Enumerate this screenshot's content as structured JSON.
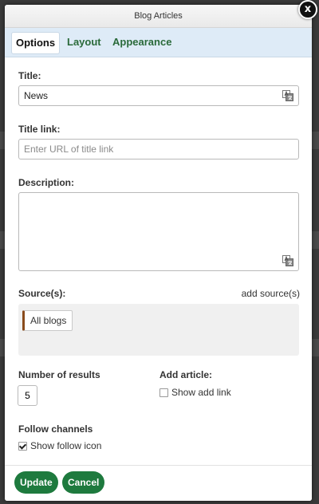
{
  "dialog": {
    "title": "Blog Articles",
    "close_label": "x"
  },
  "tabs": [
    {
      "label": "Options",
      "active": true
    },
    {
      "label": "Layout",
      "active": false
    },
    {
      "label": "Appearance",
      "active": false
    }
  ],
  "form": {
    "title_label": "Title:",
    "title_value": "News",
    "title_link_label": "Title link:",
    "title_link_placeholder": "Enter URL of title link",
    "description_label": "Description:",
    "sources_label": "Source(s):",
    "add_source_label": "add source(s)",
    "sources": [
      {
        "label": "All blogs"
      }
    ],
    "number_results_label": "Number of results",
    "number_results_value": "5",
    "add_article_label": "Add article:",
    "show_add_link_label": "Show add link",
    "show_add_link_checked": false,
    "follow_channels_label": "Follow channels",
    "show_follow_icon_label": "Show follow icon",
    "show_follow_icon_checked": true
  },
  "footer": {
    "update_label": "Update",
    "cancel_label": "Cancel"
  },
  "colors": {
    "accent_green": "#1e7a3e",
    "tab_bar": "#deebf7",
    "source_chip_marker": "#8a4b1c"
  },
  "icons": {
    "translate": "translate-icon",
    "close": "close-icon"
  }
}
